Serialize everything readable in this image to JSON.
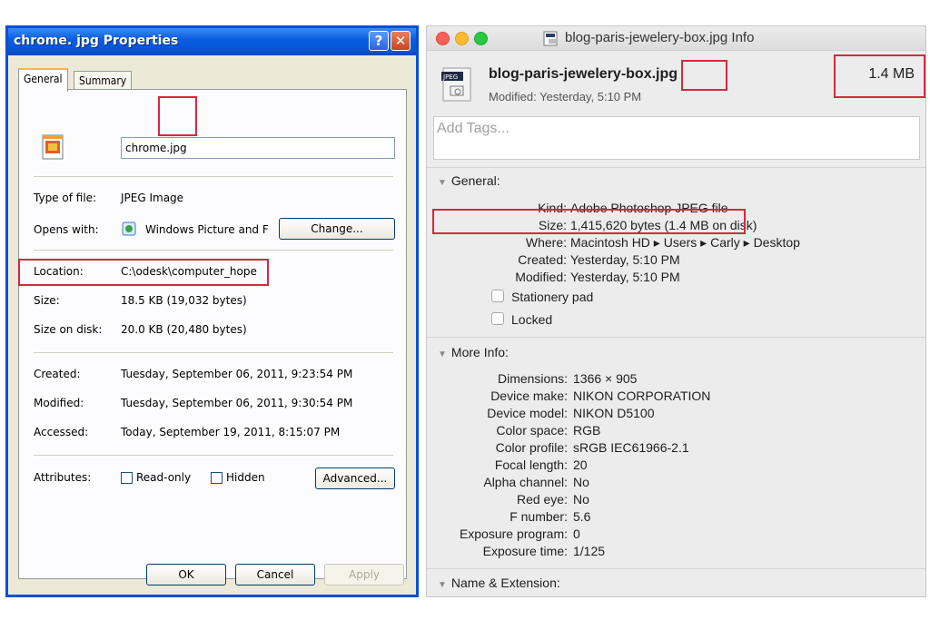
{
  "windows_dialog": {
    "title": "chrome. jpg Properties",
    "help_glyph": "?",
    "close_glyph": "✕",
    "tabs": [
      "General",
      "Summary"
    ],
    "filename": "chrome.jpg",
    "rows": {
      "type_label": "Type of file:",
      "type_value": "JPEG Image",
      "opens_label": "Opens with:",
      "opens_value": "Windows Picture and F",
      "change_button": "Change...",
      "location_label": "Location:",
      "location_value": "C:\\odesk\\computer_hope",
      "size_label": "Size:",
      "size_value": "18.5 KB (19,032 bytes)",
      "disk_label": "Size on disk:",
      "disk_value": "20.0 KB (20,480 bytes)",
      "created_label": "Created:",
      "created_value": "Tuesday, September 06, 2011, 9:23:54 PM",
      "modified_label": "Modified:",
      "modified_value": "Tuesday, September 06, 2011, 9:30:54 PM",
      "accessed_label": "Accessed:",
      "accessed_value": "Today, September 19, 2011, 8:15:07 PM",
      "attributes_label": "Attributes:",
      "readonly_label": "Read-only",
      "hidden_label": "Hidden",
      "advanced_button": "Advanced..."
    },
    "buttons": {
      "ok": "OK",
      "cancel": "Cancel",
      "apply": "Apply"
    }
  },
  "mac_info": {
    "title": "blog-paris-jewelery-box.jpg Info",
    "file_name": "blog-paris-jewelery-box.jpg",
    "modified_line": "Modified: Yesterday, 5:10 PM",
    "size_short": "1.4 MB",
    "tags_placeholder": "Add Tags...",
    "icon_text": "JPEG",
    "general": {
      "header": "General:",
      "rows": [
        {
          "label": "Kind:",
          "value": "Adobe Photoshop JPEG file"
        },
        {
          "label": "Size:",
          "value": "1,415,620 bytes (1.4 MB on disk)"
        },
        {
          "label": "Where:",
          "value": "Macintosh HD ▸ Users ▸ Carly ▸ Desktop"
        },
        {
          "label": "Created:",
          "value": "Yesterday, 5:10 PM"
        },
        {
          "label": "Modified:",
          "value": "Yesterday, 5:10 PM"
        }
      ],
      "stationery": "Stationery pad",
      "locked": "Locked"
    },
    "more_info": {
      "header": "More Info:",
      "rows": [
        {
          "label": "Dimensions:",
          "value": "1366 × 905"
        },
        {
          "label": "Device make:",
          "value": "NIKON CORPORATION"
        },
        {
          "label": "Device model:",
          "value": "NIKON D5100"
        },
        {
          "label": "Color space:",
          "value": "RGB"
        },
        {
          "label": "Color profile:",
          "value": "sRGB IEC61966-2.1"
        },
        {
          "label": "Focal length:",
          "value": "20"
        },
        {
          "label": "Alpha channel:",
          "value": "No"
        },
        {
          "label": "Red eye:",
          "value": "No"
        },
        {
          "label": "F number:",
          "value": "5.6"
        },
        {
          "label": "Exposure program:",
          "value": "0"
        },
        {
          "label": "Exposure time:",
          "value": "1/125"
        }
      ]
    },
    "name_extension_header": "Name & Extension:"
  },
  "colors": {
    "xp_titlebar": "#0553d6",
    "highlight": "#d6283c",
    "mac_red": "#fc5f57",
    "mac_yellow": "#fdbc2e",
    "mac_green": "#28c840"
  }
}
